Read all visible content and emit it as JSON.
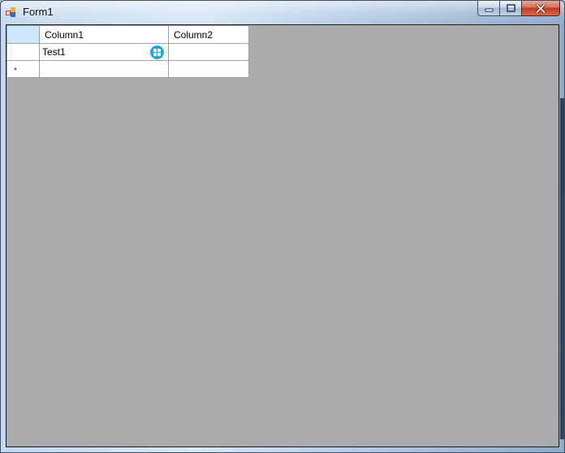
{
  "window": {
    "title": "Form1",
    "icon": "winforms-app-icon",
    "caption_buttons": [
      "minimize",
      "maximize",
      "close"
    ]
  },
  "grid": {
    "columns": [
      "Column1",
      "Column2"
    ],
    "rows": [
      {
        "Column1": "Test1",
        "Column2": "",
        "editing": true
      },
      {
        "Column1": "",
        "Column2": "",
        "new_row": true
      }
    ],
    "new_row_glyph": "*"
  },
  "colors": {
    "client_background": "#ababab",
    "header_selected": "#cce8ff",
    "edit_badge": "#1aa7e6"
  }
}
